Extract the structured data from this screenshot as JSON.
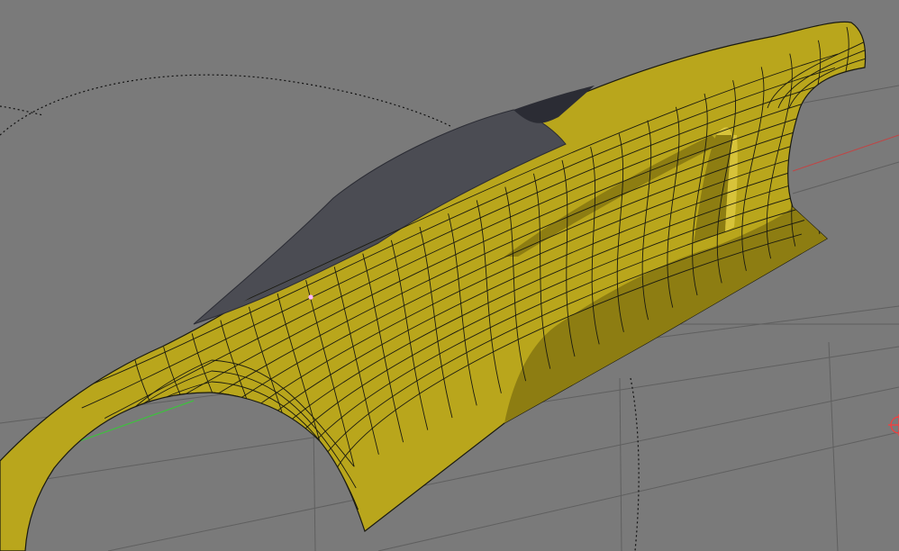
{
  "viewport": {
    "background_color": "#7a7a7a",
    "grid_color": "#5f5f5f",
    "x_axis_color": "#c04545",
    "y_axis_color": "#3fbf3f",
    "cursor_color": "#ff3a3a",
    "lamp_outline_color": "#111111"
  },
  "model": {
    "body_color": "#b9a61c",
    "body_shade_color": "#8d7d12",
    "body_highlight_color": "#d7c33a",
    "wire_color": "#1a1a10",
    "glass_color": "#4b4c53",
    "glass_dark_color": "#2b2c34",
    "selected_vertex_color": "#ffb6ff"
  },
  "icons": {
    "cursor": "3d-cursor-icon",
    "lamp": "lamp-outline-icon"
  }
}
